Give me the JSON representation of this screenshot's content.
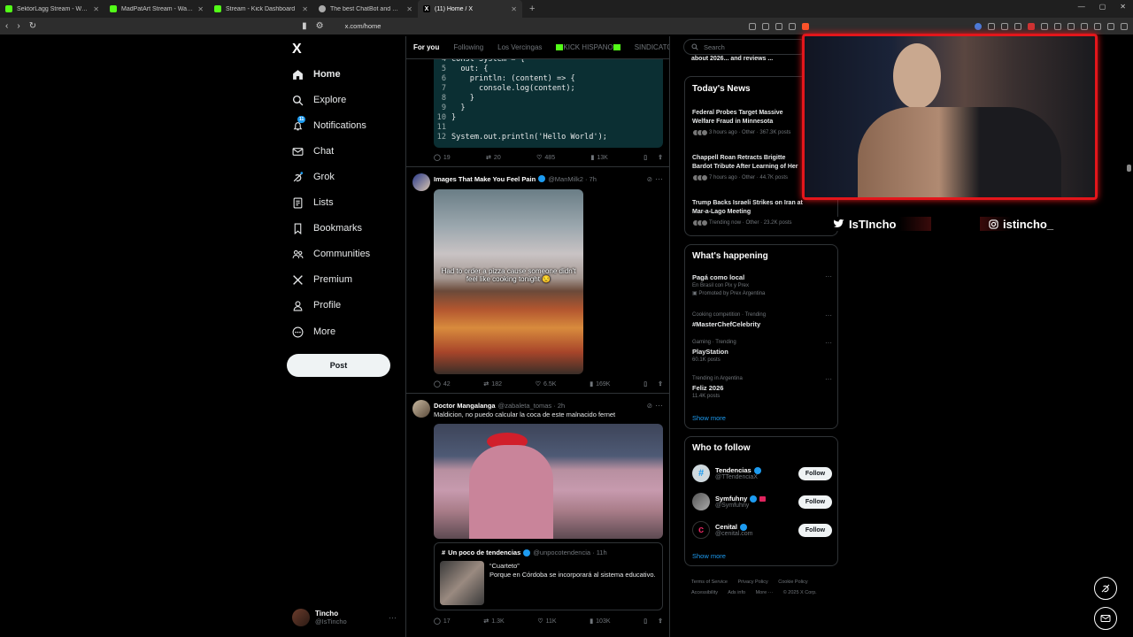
{
  "browser": {
    "tabs": [
      {
        "label": "SektorLagg Stream - Watch Live o",
        "color": "#53fc18",
        "active": false
      },
      {
        "label": "MadPatArt Stream - Watch Live o",
        "color": "#53fc18",
        "active": false
      },
      {
        "label": "Stream - Kick Dashboard",
        "color": "#53fc18",
        "active": false
      },
      {
        "label": "The best ChatBot and Widgets fo",
        "color": "#aaaaaa",
        "active": false
      },
      {
        "label": "(11) Home / X",
        "color": "#ffffff",
        "active": true
      }
    ],
    "add_tab": "+",
    "url": "x.com/home"
  },
  "sidebar": {
    "logo": "X",
    "items": [
      {
        "label": "Home",
        "icon": "home-icon"
      },
      {
        "label": "Explore",
        "icon": "search-icon"
      },
      {
        "label": "Notifications",
        "icon": "bell-icon"
      },
      {
        "label": "Chat",
        "icon": "mail-icon"
      },
      {
        "label": "Grok",
        "icon": "grok-icon"
      },
      {
        "label": "Lists",
        "icon": "list-icon"
      },
      {
        "label": "Bookmarks",
        "icon": "bookmark-icon"
      },
      {
        "label": "Communities",
        "icon": "people-icon"
      },
      {
        "label": "Premium",
        "icon": "x-icon"
      },
      {
        "label": "Profile",
        "icon": "person-icon"
      },
      {
        "label": "More",
        "icon": "more-circle-icon"
      }
    ],
    "notif_badge": "11",
    "post_button": "Post",
    "account": {
      "name": "Tincho",
      "handle": "@IsTincho"
    }
  },
  "feed": {
    "tabs": [
      "For you",
      "Following",
      "Los Vercingas",
      "KICK HISPANO",
      "SINDICATO D"
    ],
    "code_lines": [
      {
        "n": "4",
        "t": "const System = {"
      },
      {
        "n": "5",
        "t": "  out: {"
      },
      {
        "n": "6",
        "t": "    println: (content) => {"
      },
      {
        "n": "7",
        "t": "      console.log(content);"
      },
      {
        "n": "8",
        "t": "    }"
      },
      {
        "n": "9",
        "t": "  }"
      },
      {
        "n": "10",
        "t": "}"
      },
      {
        "n": "11",
        "t": ""
      },
      {
        "n": "12",
        "t": "System.out.println('Hello World');"
      }
    ],
    "post0_actions": {
      "replies": "19",
      "reposts": "20",
      "likes": "485",
      "views": "13K"
    },
    "post1": {
      "name": "Images That Make You Feel Pain",
      "handle": "@ManMilk2 · 7h",
      "caption": "Had to order a pizza cause someone didn't feel like cooking tonight 😒",
      "actions": {
        "replies": "42",
        "reposts": "182",
        "likes": "6.5K",
        "views": "169K"
      }
    },
    "post2": {
      "name": "Doctor Mangalanga",
      "handle": "@zabaleta_tomas · 2h",
      "text": "Maldicion, no puedo calcular la coca de este malnacido fernet",
      "quote": {
        "name": "Un poco de tendencias",
        "handle": "@unpocotendencia · 11h",
        "title": "“Cuarteto”",
        "text": "Porque en Córdoba se incorporará al sistema educativo."
      },
      "actions": {
        "replies": "17",
        "reposts": "1.3K",
        "likes": "11K",
        "views": "103K"
      }
    }
  },
  "right": {
    "search_placeholder": "Search",
    "snippet": "about 2026... and reviews ...",
    "news_title": "Today's News",
    "news": [
      {
        "title": "Federal Probes Target Massive Welfare Fraud in Minnesota",
        "meta": "3 hours ago · Other · 367.3K posts"
      },
      {
        "title": "Chappell Roan Retracts Brigitte Bardot Tribute After Learning of Her Views",
        "meta": "7 hours ago · Other · 44.7K posts"
      },
      {
        "title": "Trump Backs Israeli Strikes on Iran at Mar-a-Lago Meeting",
        "meta": "Trending now · Other · 23.2K posts"
      }
    ],
    "happening_title": "What's happening",
    "trends": [
      {
        "sub": "",
        "title": "Pagá como local",
        "extra": "En Brasil con Pix y Prex",
        "extra2": "Promoted by Prex Argentina"
      },
      {
        "sub": "Cooking competition · Trending",
        "title": "#MasterChefCelebrity",
        "extra": "",
        "extra2": ""
      },
      {
        "sub": "Gaming · Trending",
        "title": "PlayStation",
        "extra": "60.1K posts",
        "extra2": ""
      },
      {
        "sub": "Trending in Argentina",
        "title": "Feliz 2026",
        "extra": "11.4K posts",
        "extra2": ""
      }
    ],
    "show_more": "Show more",
    "wtf_title": "Who to follow",
    "follow": [
      {
        "name": "Tendencias",
        "handle": "@TTendenciaX",
        "btn": "Follow"
      },
      {
        "name": "Symfuhny",
        "handle": "@Symfuhny",
        "btn": "Follow"
      },
      {
        "name": "Cenital",
        "handle": "@cenital.com",
        "btn": "Follow"
      }
    ],
    "footer": [
      "Terms of Service",
      "Privacy Policy",
      "Cookie Policy",
      "Accessibility",
      "Ads info",
      "More ···",
      "© 2025 X Corp."
    ]
  },
  "overlay": {
    "twitter": "IsTIncho",
    "instagram": "istincho_"
  },
  "colors": {
    "accent": "#1d9bf0",
    "cam_border": "#e3161b",
    "kick": "#53fc18"
  }
}
